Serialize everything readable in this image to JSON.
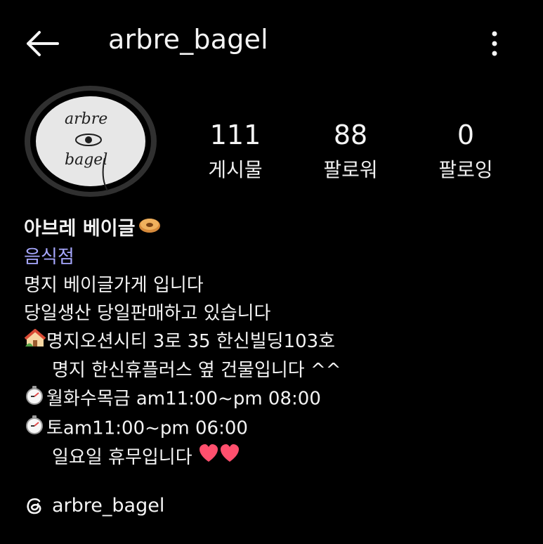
{
  "header": {
    "username": "arbre_bagel",
    "back_icon": "arrow-left-icon",
    "more_icon": "vertical-dots-icon"
  },
  "avatar": {
    "text_top": "arbre",
    "text_bottom": "bagel"
  },
  "stats": [
    {
      "value": "111",
      "label": "게시물"
    },
    {
      "value": "88",
      "label": "팔로워"
    },
    {
      "value": "0",
      "label": "팔로잉"
    }
  ],
  "bio": {
    "name": "아브레 베이글",
    "category": "음식점",
    "lines": [
      "명지 베이글가게 입니다",
      "당일생산 당일판매하고 있습니다",
      "명지오션시티 3로 35 한신빌딩103호",
      "명지 한신휴플러스 옆 건물입니다 ^^",
      "월화수목금 am11:00~pm 08:00",
      "토am11:00~pm 06:00",
      "일요일 휴무입니다"
    ]
  },
  "threads": {
    "handle": "arbre_bagel",
    "icon": "threads-icon"
  },
  "colors": {
    "background": "#000000",
    "text": "#f5f5f5",
    "category": "#a7a8ff",
    "heart": "#ff4f6d"
  }
}
